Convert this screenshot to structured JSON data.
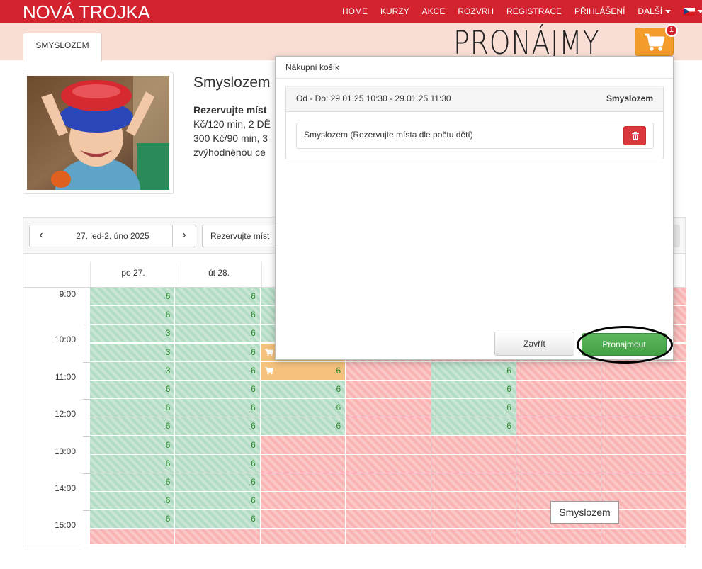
{
  "navbar": {
    "brand": "NOVÁ TROJKA",
    "items": [
      "HOME",
      "KURZY",
      "AKCE",
      "ROZVRH",
      "REGISTRACE",
      "PŘIHLÁŠENÍ",
      "DALŠÍ"
    ],
    "language_icon": "czech-flag-icon"
  },
  "subheader": {
    "tab": "SMYSLOZEM",
    "title": "PRONÁJMY",
    "cart_count": "1"
  },
  "product": {
    "title": "Smyslozem",
    "desc_bold": "Rezervujte míst",
    "desc_lines": [
      "Kč/120 min, 2 DĚ",
      "300 Kč/90 min, 3",
      "zvýhodněnou ce"
    ]
  },
  "calendar": {
    "prev_icon": "chevron-left-icon",
    "next_icon": "chevron-right-icon",
    "date_range": "27. led-2. úno 2025",
    "service_select": "Rezervujte míst",
    "days": [
      "po 27.",
      "út 28."
    ],
    "times": [
      "9:00",
      "10:00",
      "11:00",
      "12:00",
      "13:00",
      "14:00",
      "15:00"
    ],
    "columns": [
      {
        "slots": [
          [
            "g",
            "6"
          ],
          [
            "g",
            "6"
          ],
          [
            "g",
            "3"
          ],
          [
            "g",
            "3"
          ],
          [
            "g",
            "3"
          ],
          [
            "g",
            "6"
          ],
          [
            "g",
            "6"
          ],
          [
            "g",
            "6"
          ],
          [
            "g",
            "6"
          ],
          [
            "g",
            "6"
          ],
          [
            "g",
            "6"
          ],
          [
            "g",
            "6"
          ],
          [
            "g",
            "6"
          ],
          [
            "r",
            ""
          ]
        ]
      },
      {
        "slots": [
          [
            "g",
            "6"
          ],
          [
            "g",
            "6"
          ],
          [
            "g",
            "6"
          ],
          [
            "g",
            "6"
          ],
          [
            "g",
            "6"
          ],
          [
            "g",
            "6"
          ],
          [
            "g",
            "6"
          ],
          [
            "g",
            "6"
          ],
          [
            "g",
            "6"
          ],
          [
            "g",
            "6"
          ],
          [
            "g",
            "6"
          ],
          [
            "g",
            "6"
          ],
          [
            "g",
            "6"
          ],
          [
            "r",
            ""
          ]
        ]
      },
      {
        "slots": [
          [
            "g",
            ""
          ],
          [
            "g",
            ""
          ],
          [
            "g",
            ""
          ],
          [
            "o",
            ""
          ],
          [
            "o",
            "6"
          ],
          [
            "g",
            "6"
          ],
          [
            "g",
            "6"
          ],
          [
            "g",
            "6"
          ],
          [
            "r",
            ""
          ],
          [
            "r",
            ""
          ],
          [
            "r",
            ""
          ],
          [
            "r",
            ""
          ],
          [
            "r",
            ""
          ],
          [
            "r",
            ""
          ]
        ]
      },
      {
        "slots": [
          [
            "r",
            ""
          ],
          [
            "r",
            ""
          ],
          [
            "r",
            ""
          ],
          [
            "r",
            ""
          ],
          [
            "r",
            ""
          ],
          [
            "r",
            ""
          ],
          [
            "r",
            ""
          ],
          [
            "r",
            ""
          ],
          [
            "r",
            ""
          ],
          [
            "r",
            ""
          ],
          [
            "r",
            ""
          ],
          [
            "r",
            ""
          ],
          [
            "r",
            ""
          ],
          [
            "r",
            ""
          ]
        ]
      },
      {
        "slots": [
          [
            "r",
            ""
          ],
          [
            "r",
            ""
          ],
          [
            "r",
            ""
          ],
          [
            "r",
            ""
          ],
          [
            "g",
            "6"
          ],
          [
            "g",
            "6"
          ],
          [
            "g",
            "6"
          ],
          [
            "g",
            "6"
          ],
          [
            "r",
            ""
          ],
          [
            "r",
            ""
          ],
          [
            "r",
            ""
          ],
          [
            "r",
            ""
          ],
          [
            "r",
            ""
          ],
          [
            "r",
            ""
          ]
        ]
      },
      {
        "slots": [
          [
            "r",
            ""
          ],
          [
            "r",
            ""
          ],
          [
            "r",
            ""
          ],
          [
            "r",
            ""
          ],
          [
            "r",
            ""
          ],
          [
            "r",
            ""
          ],
          [
            "r",
            ""
          ],
          [
            "r",
            ""
          ],
          [
            "r",
            ""
          ],
          [
            "r",
            ""
          ],
          [
            "r",
            ""
          ],
          [
            "r",
            ""
          ],
          [
            "r",
            ""
          ],
          [
            "r",
            ""
          ]
        ]
      },
      {
        "slots": [
          [
            "r",
            ""
          ],
          [
            "r",
            ""
          ],
          [
            "r",
            ""
          ],
          [
            "r",
            ""
          ],
          [
            "r",
            ""
          ],
          [
            "r",
            ""
          ],
          [
            "r",
            ""
          ],
          [
            "r",
            ""
          ],
          [
            "r",
            ""
          ],
          [
            "r",
            ""
          ],
          [
            "r",
            ""
          ],
          [
            "r",
            ""
          ],
          [
            "r",
            ""
          ],
          [
            "r",
            ""
          ]
        ]
      }
    ],
    "tooltip": "Smyslozem"
  },
  "cart_modal": {
    "title": "Nákupní košík",
    "booking_range": "Od - Do:  29.01.25 10:30 - 29.01.25 11:30",
    "booking_name": "Smyslozem",
    "item_label": "Smyslozem (Rezervujte místa dle počtu dětí)",
    "delete_icon": "trash-icon",
    "close_label": "Zavřít",
    "rent_label": "Pronajmout"
  },
  "colors": {
    "brand_red": "#d2232f",
    "available_green": "#b2dcc3",
    "unavailable_red": "#f9b3b3",
    "in_cart_orange": "#f5c27e",
    "cart_button_orange": "#f39c2c",
    "rent_green": "#5cb85c"
  }
}
